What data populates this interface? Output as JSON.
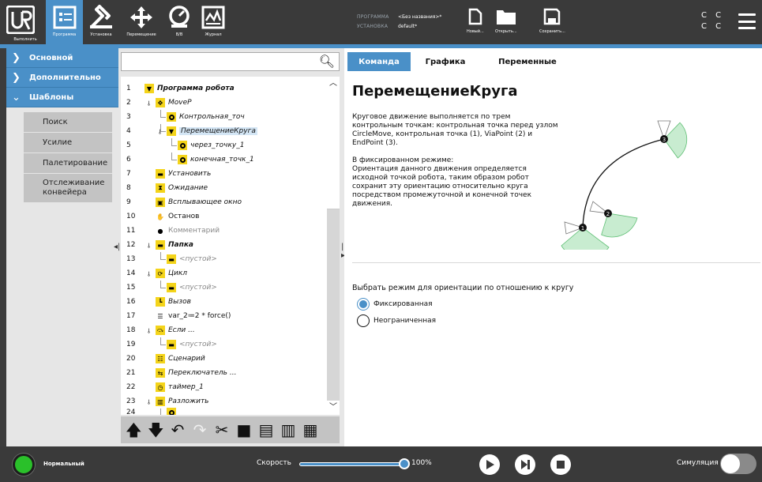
{
  "topbar": {
    "buttons": [
      {
        "label": "Выполнить",
        "icon": "run-icon"
      },
      {
        "label": "Программа",
        "icon": "program-icon",
        "active": true
      },
      {
        "label": "Установка",
        "icon": "installation-icon"
      },
      {
        "label": "Перемещение",
        "icon": "move-icon"
      },
      {
        "label": "В/В",
        "icon": "io-icon"
      },
      {
        "label": "Журнал",
        "icon": "log-icon"
      }
    ],
    "program_key": "ПРОГРАММА",
    "program_value": "<Без названия>*",
    "installation_key": "УСТАНОВКА",
    "installation_value": "default*",
    "new_label": "Новый...",
    "open_label": "Открыть...",
    "save_label": "Сохранить...",
    "cc_top": "C C",
    "cc_bottom": "C C"
  },
  "leftnav": {
    "basic": "Основной",
    "advanced": "Дополнительно",
    "templates": "Шаблоны",
    "template_items": [
      "Поиск",
      "Усилие",
      "Палетирование",
      "Отслеживание конвейера"
    ]
  },
  "tree": {
    "rows": [
      {
        "num": "1",
        "text": "Программа робота",
        "icon": "program-flag-icon"
      },
      {
        "num": "2",
        "text": "MoveP",
        "icon": "move-icon"
      },
      {
        "num": "3",
        "text": "Контрольная_точ",
        "icon": "waypoint-icon"
      },
      {
        "num": "4",
        "text": "ПеремещениеКруга",
        "icon": "circle-move-icon",
        "selected": true
      },
      {
        "num": "5",
        "text": "через_точку_1",
        "icon": "waypoint-icon"
      },
      {
        "num": "6",
        "text": "конечная_точк_1",
        "icon": "waypoint-icon"
      },
      {
        "num": "7",
        "text": "Установить",
        "icon": "set-icon"
      },
      {
        "num": "8",
        "text": "Ожидание",
        "icon": "wait-icon"
      },
      {
        "num": "9",
        "text": "Всплывающее окно",
        "icon": "popup-icon"
      },
      {
        "num": "10",
        "text": "Останов",
        "icon": "halt-icon"
      },
      {
        "num": "11",
        "text": "Комментарий",
        "icon": "comment-icon"
      },
      {
        "num": "12",
        "text": "Папка",
        "icon": "folder-icon"
      },
      {
        "num": "13",
        "text": "<пустой>",
        "icon": "empty-icon"
      },
      {
        "num": "14",
        "text": "Цикл",
        "icon": "loop-icon"
      },
      {
        "num": "15",
        "text": "<пустой>",
        "icon": "empty-icon"
      },
      {
        "num": "16",
        "text": "Вызов",
        "icon": "call-icon"
      },
      {
        "num": "17",
        "text": "var_2≔2 * force()",
        "icon": "assignment-icon"
      },
      {
        "num": "18",
        "text": "Если ...",
        "icon": "if-icon"
      },
      {
        "num": "19",
        "text": "<пустой>",
        "icon": "empty-icon"
      },
      {
        "num": "20",
        "text": "Сценарий",
        "icon": "script-icon"
      },
      {
        "num": "21",
        "text": "Переключатель ...",
        "icon": "switch-icon"
      },
      {
        "num": "22",
        "text": "таймер_1",
        "icon": "timer-icon"
      },
      {
        "num": "23",
        "text": "Разложить",
        "icon": "palletizing-icon"
      },
      {
        "num": "24",
        "text": "",
        "icon": "waypoint-icon"
      }
    ]
  },
  "content": {
    "tabs": [
      "Команда",
      "Графика",
      "Переменные"
    ],
    "title": "ПеремещениеКруга",
    "desc1": "Круговое движение выполняется по трем контрольным точкам: контрольная точка перед узлом CircleMove, контрольная точка (1), ViaPoint (2) и EndPoint (3).",
    "desc2": "В фиксированном режиме:\nОриентация данного движения определяется исходной точкой робота, таким образом робот сохранит эту ориентацию относительно круга посредством промежуточной и конечной точек движения.",
    "diagram_labels": [
      "1",
      "2",
      "3"
    ],
    "orient_label": "Выбрать режим для ориентации по отношению к кругу",
    "radio_fixed": "Фиксированная",
    "radio_unconstrained": "Неограниченная",
    "selected_mode": "Фиксированная"
  },
  "footer": {
    "status": "Нормальный",
    "speed_label": "Скорость",
    "speed_value": "100%",
    "speed_percent": 100,
    "sim_label": "Симуляция"
  },
  "colors": {
    "accent": "#4a90c8",
    "status_green": "#2ac02a",
    "node_yellow": "#f4d41a",
    "dark_bar": "#3a3a3a"
  }
}
